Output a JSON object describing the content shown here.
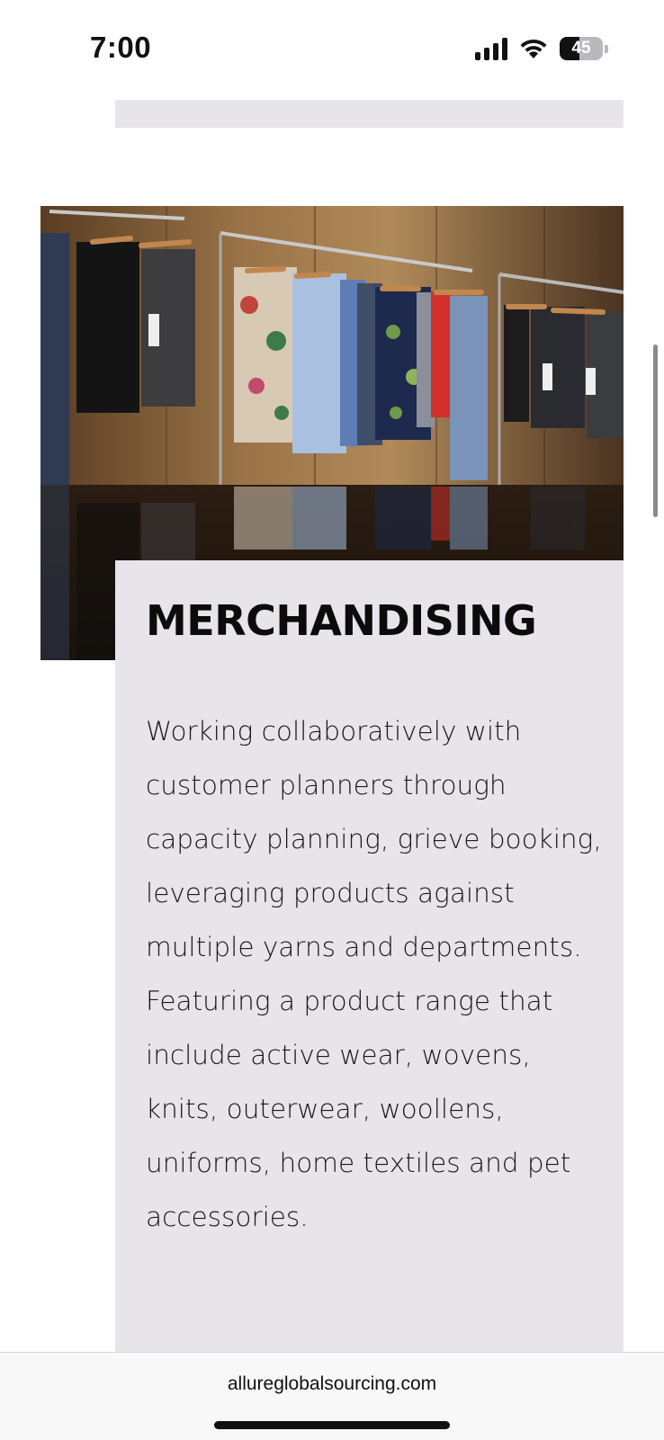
{
  "status_bar": {
    "time": "7:00",
    "battery_percent": "45",
    "icons": [
      "cellular-signal-icon",
      "wifi-icon",
      "battery-icon"
    ]
  },
  "photo": {
    "subject": "clothing-rack-photo"
  },
  "section": {
    "heading": "MERCHANDISING",
    "body": "Working collaboratively with customer planners through capacity planning, grieve booking, leveraging products against multiple yarns and departments. Featuring a product range that include active wear, wovens, knits, outerwear, woollens, uniforms, home textiles and pet accessories."
  },
  "browser": {
    "url": "allureglobalsourcing.com"
  },
  "colors": {
    "panel_gray": "#e7e5e9",
    "text": "#111111"
  }
}
